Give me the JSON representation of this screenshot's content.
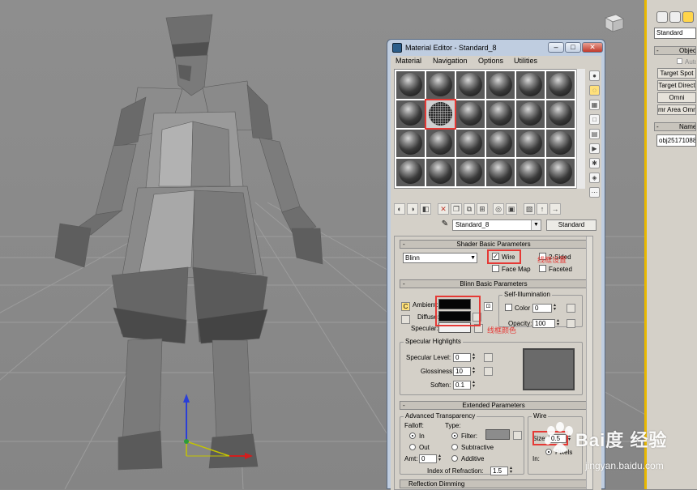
{
  "viewport": {
    "figure": "character-model",
    "gizmo_axes": [
      "blue",
      "green",
      "red"
    ]
  },
  "command_panel": {
    "combo_value": "Standard",
    "rollout_objects": "Objec",
    "autogrid": "Autc",
    "buttons": [
      "Target Spot",
      "Target Direct",
      "Omni",
      "mr Area Omni"
    ],
    "rollout_name": "Name a",
    "name_value": "obj25171088"
  },
  "material_editor": {
    "title": "Material Editor - Standard_8",
    "window_buttons": {
      "minimize": "–",
      "maximize": "□",
      "close": "✕"
    },
    "menu": [
      "Material",
      "Navigation",
      "Options",
      "Utilities"
    ],
    "slots": {
      "rows": 4,
      "cols": 6,
      "active_index": 7
    },
    "material_name": "Standard_8",
    "material_type": "Standard",
    "shader_basic": {
      "title": "Shader Basic Parameters",
      "shader": "Blinn",
      "wire": {
        "label": "Wire",
        "checked": true
      },
      "two_sided": {
        "label": "2-Sided",
        "checked": false
      },
      "face_map": {
        "label": "Face Map",
        "checked": false
      },
      "faceted": {
        "label": "Faceted",
        "checked": false
      }
    },
    "blinn_basic": {
      "title": "Blinn Basic Parameters",
      "self_illum_group": "Self-Illumination",
      "ambient_label": "Ambient:",
      "diffuse_label": "Diffuse:",
      "specular_label": "Specular:",
      "ambient_color": "#050505",
      "diffuse_color": "#050505",
      "specular_color": "#f2f2f2",
      "color_label": "Color",
      "color_value": "0",
      "opacity_label": "Opacity:",
      "opacity_value": "100",
      "lock_icon": "C"
    },
    "specular_highlights": {
      "title": "Specular Highlights",
      "level_label": "Specular Level:",
      "level_value": "0",
      "gloss_label": "Glossiness:",
      "gloss_value": "10",
      "soften_label": "Soften:",
      "soften_value": "0.1"
    },
    "extended": {
      "title": "Extended Parameters",
      "adv_transparency": "Advanced Transparency",
      "falloff_label": "Falloff:",
      "type_label": "Type:",
      "in_label": "In",
      "out_label": "Out",
      "filter_label": "Filter:",
      "subtractive_label": "Subtractive",
      "additive_label": "Additive",
      "amt_label": "Amt:",
      "amt_value": "0",
      "ior_label": "Index of Refraction:",
      "ior_value": "1.5",
      "filter_color": "#8c8c8c",
      "wire_group": "Wire",
      "wire_size_label": "Size:",
      "wire_size_value": "0.5",
      "in_short": "In:",
      "pixels_label": "Pixels"
    },
    "reflection_dimming": {
      "title": "Reflection Dimming"
    }
  },
  "annotations": {
    "wire_note": "线框设置",
    "color_note": "线框颜色"
  },
  "watermark": {
    "logo": "Bai度 经验",
    "url": "jingyan.baidu.com"
  },
  "colors": {
    "highlight": "#e53935",
    "accent_panel": "#e9b800",
    "title_bar": "#bfcde0"
  }
}
